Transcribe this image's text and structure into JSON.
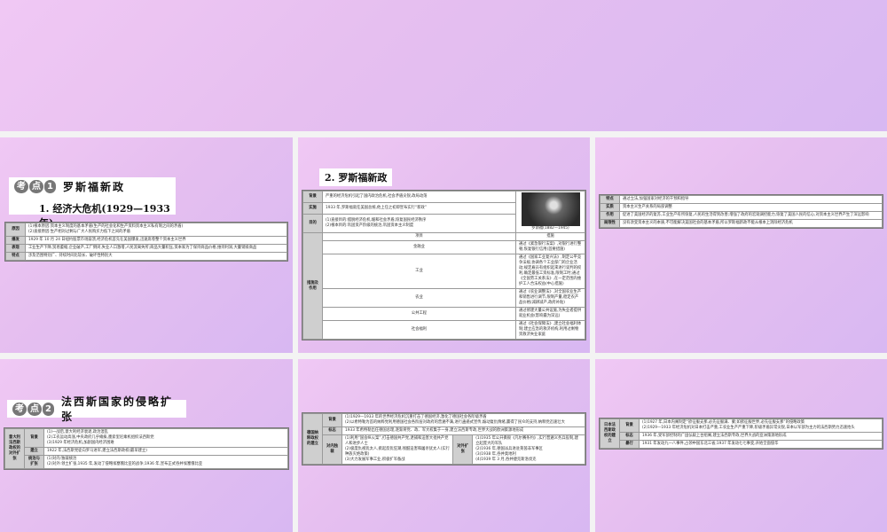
{
  "slide1": {
    "badge": [
      "考",
      "点",
      "1"
    ],
    "kaodian": "罗斯福新政",
    "subtitle": "1. 经济大危机(1929—1933 年)",
    "rows": [
      [
        {
          "t": "原因",
          "h": 1
        },
        {
          "t": "(1)根本原因:资本主义制度的基本矛盾(生产的社会化和生产资料资本主义私有制之间的矛盾)\n(2)直接原因:生产相对过剩与广大人民购买力低下之间的矛盾"
        }
      ],
      [
        {
          "t": "爆发",
          "h": 1
        },
        {
          "t": "1929 年 10 月 24 日纽约股票市场崩溃,经济危机首先在美国爆发,迅速席卷整个资本主义世界"
        }
      ],
      [
        {
          "t": "表现",
          "h": 1
        },
        {
          "t": "工业生产下降,贸易萎缩,企业破产,工厂倒闭,失业人口激增,人民流离失所;商品大量积压,资本家为了保持商品价格,维持利润,大量销毁商品"
        }
      ],
      [
        {
          "t": "特点",
          "h": 1
        },
        {
          "t": "涉及范围特别广、持续时间比较长、破坏性特别大"
        }
      ]
    ]
  },
  "slide2": {
    "subtitle": "2. 罗斯福新政",
    "photo_caption": "罗斯福(1882—1945)",
    "rows": [
      [
        {
          "t": "背景",
          "h": 1
        },
        {
          "t": "严重的经济危机引起了国内政治危机,社会矛盾尖锐,政局动荡",
          "cs": 2
        }
      ],
      [
        {
          "t": "实施",
          "h": 1
        },
        {
          "t": "1933 年,罗斯福就任美国总统,他上任之初即宣布实行“新政”",
          "cs": 2
        }
      ],
      [
        {
          "t": "目的",
          "h": 1
        },
        {
          "t": "(1)直接目的:摆脱经济危机,缓和社会矛盾,恢复国民经济秩序\n(2)根本目的:巩固资产阶级的统治,巩固资本主义制度",
          "cs": 2
        }
      ],
      [
        {
          "t": "措施及作用",
          "h": 1,
          "rs": 6
        },
        {
          "t": "项目",
          "c": 1
        },
        {
          "t": "措施",
          "c": 1
        }
      ],
      [
        {
          "t": "金融业",
          "c": 1
        },
        {
          "t": "通过《紧急银行法案》,对银行进行整顿,恢复银行信用(首要措施)"
        }
      ],
      [
        {
          "t": "工业",
          "c": 1
        },
        {
          "t": "通过《国家工业复兴法》,制定公平竞争法规,协调各个工业部门的企业活动;规定雇员有组织起来进行谈判的权利,确定最低工资标准,限制工时;通过《全国劳工关系法》,在一定范围内维护工人合法权益(中心措施)"
        }
      ],
      [
        {
          "t": "农业",
          "c": 1
        },
        {
          "t": "通过《农业调整法》,对全国农业生产和销售进行调节,限制产量,稳定农产品价格(减耕减产,政府补贴)"
        }
      ],
      [
        {
          "t": "公共工程",
          "c": 1
        },
        {
          "t": "通过修建大量公共设施,为失业者提供就业机会(影响最为深远)"
        }
      ],
      [
        {
          "t": "社会福利",
          "c": 1
        },
        {
          "t": "通过《社会保障法》,建立社会福利体制;建立应急的救济机构,利用过剩物资救济失业家庭"
        }
      ]
    ]
  },
  "slide3": {
    "rows": [
      [
        {
          "t": "特点",
          "h": 1
        },
        {
          "t": "通过立法,加强国家对经济的干预和指导"
        }
      ],
      [
        {
          "t": "实质",
          "h": 1
        },
        {
          "t": "资本主义生产关系的局部调整"
        }
      ],
      [
        {
          "t": "作用",
          "h": 1
        },
        {
          "t": "促进了美国经济的复苏,工业生产有所恢复,人民的生活得到改善;增强了政府的宏观调控能力,恢复了美国人民的信心,对资本主义世界产生了深远影响"
        }
      ],
      [
        {
          "t": "局限性",
          "h": 1
        },
        {
          "t": "没有改变资本主义的本质,不可能解决美国社会的基本矛盾,所以罗斯福新政不能从根本上消除经济危机"
        }
      ]
    ]
  },
  "slide4": {
    "badge": [
      "考",
      "点",
      "2"
    ],
    "kaodian": "法西斯国家的侵略扩张",
    "rows": [
      [
        {
          "t": "意大利法西斯政权的对外扩张",
          "h": 1,
          "rs": 3
        },
        {
          "t": "背景",
          "h": 1
        },
        {
          "t": "(1)一战后,意大利经济衰退,政治混乱\n(2)工农运动高涨,中央政府几乎瘫痪,墨索里尼乘机组织法西斯党\n(3)1929 年经济危机,加剧国内经济困难"
        }
      ],
      [
        {
          "t": "建立",
          "h": 1
        },
        {
          "t": "1922 年,法西斯党徒向罗马进军,建立法西斯政权(最早建立)"
        }
      ],
      [
        {
          "t": "统治与扩张",
          "h": 1
        },
        {
          "t": "(1)对内:独裁统治\n(2)对外:领土扩张,1935 年,发动了侵略埃塞俄比亚的战争;1936 年,宣布正式吞并埃塞俄比亚"
        }
      ]
    ]
  },
  "slide5": {
    "rows": [
      [
        {
          "t": "德国纳粹政权的建立",
          "h": 1,
          "rs": 3
        },
        {
          "t": "背景",
          "h": 1
        },
        {
          "t": "(1)1929—1933 年的世界经济危机沉重打击了德国经济,激化了德国社会各阶级矛盾\n(2)以希特勒为首的纳粹党利用德国社会各阶层对政府的普遍不满,进行蛊惑式宣传,煽动复仇情绪,赢得了民众的支持,纳粹党迅速壮大",
          "cs": 3
        }
      ],
      [
        {
          "t": "标志",
          "h": 1
        },
        {
          "t": "1933 年希特勒出任德国总理,逐渐将党、政、军大权集于一身,建立法西斯专政,世界大战的欧洲策源地形成",
          "cs": 3
        }
      ],
      [
        {
          "t": "对内独裁",
          "h": 1
        },
        {
          "t": "(1)利用“国会纵火案”,打击德国共产党,逮捕和迫害大批共产党人和进步人士\n(2)极度仇视犹太人,掀起反犹狂潮,残酷迫害和屠杀犹太人(实行种族灭绝政策)\n(3)大力发展军事工业,积极扩军备战"
        },
        {
          "t": "对外扩张",
          "h": 1
        },
        {
          "t": "(1)1935 年公开撕毁《凡尔赛条约》,实行普遍义务兵役制,建立起庞大的军队\n(2)1936 年,德国派兵进驻莱茵非军事区\n(3)1938 年,吞并奥地利\n(4)1939 年 3 月,吞并捷克斯洛伐克"
        }
      ]
    ]
  },
  "slide6": {
    "rows": [
      [
        {
          "t": "日本法西斯政权的建立",
          "h": 1,
          "rs": 3
        },
        {
          "t": "背景",
          "h": 1
        },
        {
          "t": "(1)1927 年,日本内阁制定“欲征服支那,必先征服满、蒙;如欲征服世界,必先征服支那”的侵略政策\n(2)1929—1933 年经济危机对日本打击严重,工农业生产严重下降,阶级矛盾异常尖锐,日本以军部为主力的法西斯势力迅速抬头"
        }
      ],
      [
        {
          "t": "标志",
          "h": 1
        },
        {
          "t": "1936 年,受军部控制的广田弘毅上台组阁,建立法西斯专政,世界大战的亚洲策源地形成"
        }
      ],
      [
        {
          "t": "暴行",
          "h": 1
        },
        {
          "t": "1931 年发动九一八事件,占领中国东北三省;1937 年发动七七事变,开始全面侵华"
        }
      ]
    ]
  }
}
